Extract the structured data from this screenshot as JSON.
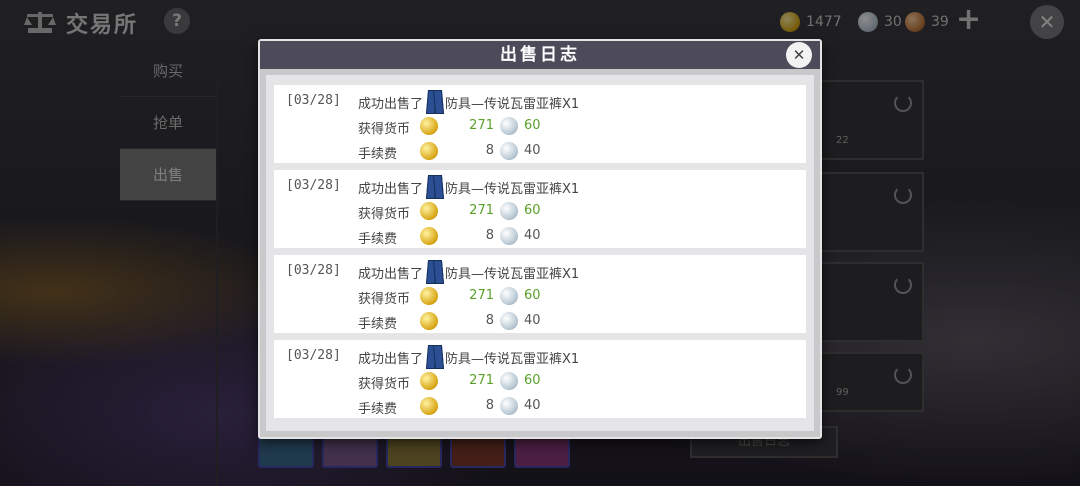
{
  "app": {
    "title": "交易所",
    "help_label": "?"
  },
  "currency": {
    "gold": "1477",
    "silver": "30",
    "copper": "39",
    "add_label": "+"
  },
  "nav": {
    "items": [
      {
        "label": "购买"
      },
      {
        "label": "抢单"
      },
      {
        "label": "出售"
      }
    ],
    "active": "出售"
  },
  "background": {
    "panel_numbers": [
      "22",
      "99"
    ],
    "log_button_label": "出售日志"
  },
  "modal": {
    "title": "出售日志",
    "entries": [
      {
        "date": "[03/28]",
        "action": "成功出售了",
        "item": "防具—传说瓦雷亚裤X1",
        "earn_label": "获得货币",
        "earn_gold": "271",
        "earn_silver": "60",
        "fee_label": "手续费",
        "fee_gold": "8",
        "fee_silver": "40"
      },
      {
        "date": "[03/28]",
        "action": "成功出售了",
        "item": "防具—传说瓦雷亚裤X1",
        "earn_label": "获得货币",
        "earn_gold": "271",
        "earn_silver": "60",
        "fee_label": "手续费",
        "fee_gold": "8",
        "fee_silver": "40"
      },
      {
        "date": "[03/28]",
        "action": "成功出售了",
        "item": "防具—传说瓦雷亚裤X1",
        "earn_label": "获得货币",
        "earn_gold": "271",
        "earn_silver": "60",
        "fee_label": "手续费",
        "fee_gold": "8",
        "fee_silver": "40"
      },
      {
        "date": "[03/28]",
        "action": "成功出售了",
        "item": "防具—传说瓦雷亚裤X1",
        "earn_label": "获得货币",
        "earn_gold": "271",
        "earn_silver": "60",
        "fee_label": "手续费",
        "fee_gold": "8",
        "fee_silver": "40"
      }
    ]
  },
  "colors": {
    "modal_header": "#4d4a5a",
    "earn_value": "#5aa02a",
    "active_nav": "#7d7b7a"
  },
  "icons": [
    "scale-icon",
    "help-icon",
    "gold-coin-icon",
    "silver-coin-icon",
    "copper-coin-icon",
    "plus-icon",
    "close-icon",
    "pants-icon",
    "refresh-icon"
  ]
}
